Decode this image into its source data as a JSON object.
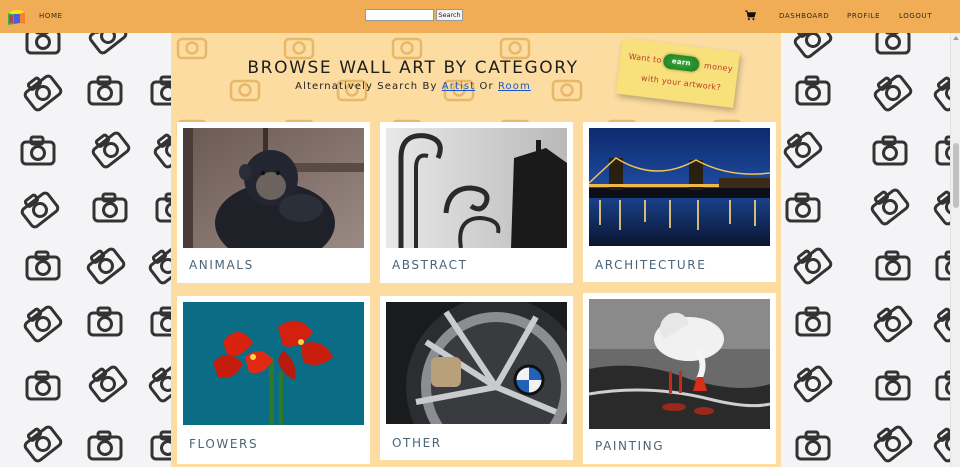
{
  "nav": {
    "home_label": "HOME",
    "search_placeholder": "",
    "search_button": "Search",
    "dashboard_label": "DASHBOARD",
    "profile_label": "PROFILE",
    "logout_label": "LOGOUT",
    "logo_icon": "cube-logo-icon",
    "cart_icon": "shopping-cart-icon"
  },
  "hero": {
    "title": "BROWSE WALL ART BY CATEGORY",
    "subtitle_prefix": "Alternatively Search By",
    "artist_link": "Artist",
    "subtitle_or": "Or",
    "room_link": "Room"
  },
  "promo": {
    "text_before": "Want to",
    "button": "earn",
    "text_after": "money",
    "text_line2": "with your artwork?"
  },
  "categories": [
    {
      "label": "ANIMALS",
      "image": "chimpanzee-photo"
    },
    {
      "label": "ABSTRACT",
      "image": "frosted-gate-photo"
    },
    {
      "label": "ARCHITECTURE",
      "image": "night-bridge-photo"
    },
    {
      "label": "FLOWERS",
      "image": "red-amaryllis-photo"
    },
    {
      "label": "OTHER",
      "image": "car-wheel-photo"
    },
    {
      "label": "PAINTING",
      "image": "swan-painting"
    }
  ],
  "colors": {
    "navbar": "#f0ad55",
    "panel": "#fcdca1",
    "card_label": "#4a6478",
    "link": "#1a57c9",
    "earn_green": "#2e8b2e"
  }
}
